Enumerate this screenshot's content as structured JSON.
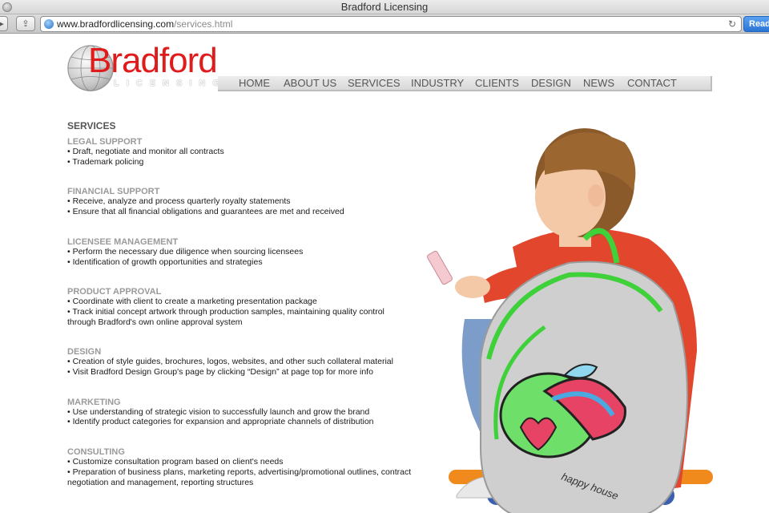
{
  "browser": {
    "window_title": "Bradford Licensing",
    "url_host": "www.bradfordlicensing.com",
    "url_path": "/services.html",
    "reload_glyph": "↻",
    "reader_label": "Reader",
    "share_glyph": "⇪",
    "back_glyph": "▸"
  },
  "logo": {
    "word": "Bradford",
    "sub": "LICENSING"
  },
  "nav": {
    "items": [
      "HOME",
      "ABOUT US",
      "SERVICES",
      "INDUSTRY",
      "CLIENTS",
      "DESIGN",
      "NEWS",
      "CONTACT"
    ]
  },
  "page": {
    "title": "SERVICES",
    "sections": [
      {
        "title": "LEGAL SUPPORT",
        "items": [
          "• Draft, negotiate and monitor all contracts",
          "• Trademark policing"
        ]
      },
      {
        "title": "FINANCIAL SUPPORT",
        "items": [
          "• Receive, analyze and process quarterly royalty statements",
          "• Ensure that all financial obligations and guarantees are met and received"
        ]
      },
      {
        "title": "LICENSEE MANAGEMENT",
        "items": [
          "• Perform the necessary due diligence when sourcing licensees",
          "• Identification of growth opportunities and strategies"
        ]
      },
      {
        "title": "PRODUCT APPROVAL",
        "items": [
          "• Coordinate with client to create a marketing presentation package",
          "• Track initial concept artwork through production samples, maintaining quality control",
          "through Bradford's own online approval system"
        ]
      },
      {
        "title": "DESIGN",
        "items": [
          "• Creation of style guides, brochures, logos, websites, and other such collateral material",
          "• Visit Bradford Design Group's page by clicking “Design” at page top for more info"
        ]
      },
      {
        "title": "MARKETING",
        "items": [
          "• Use understanding of strategic vision to successfully launch and grow the brand",
          "• Identify product categories for expansion and appropriate channels of distribution"
        ]
      },
      {
        "title": "CONSULTING",
        "items": [
          "• Customize consultation program based on client's needs",
          "• Preparation of business plans, marketing reports, advertising/promotional outlines, contract",
          "negotiation and management, reporting structures"
        ]
      }
    ]
  },
  "photo": {
    "backpack_text": "happy house"
  },
  "colors": {
    "brand_red": "#e01b1b",
    "section_gray": "#9a9a9a",
    "nav_text": "#555555"
  }
}
